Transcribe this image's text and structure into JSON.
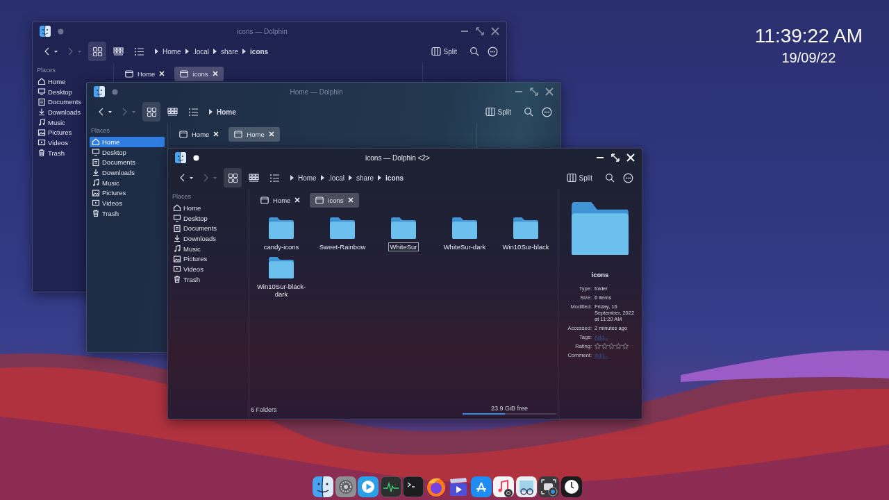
{
  "clock": {
    "time": "11:39:22 AM",
    "date": "19/09/22"
  },
  "windows": [
    {
      "title": "icons — Dolphin",
      "active": false,
      "back_disabled": false,
      "forward_disabled": true,
      "view_modes": [
        {
          "kind": "icons",
          "selected": true
        },
        {
          "kind": "compact",
          "selected": false
        },
        {
          "kind": "details",
          "selected": false
        }
      ],
      "breadcrumb": [
        "Home",
        ".local",
        "share",
        "icons"
      ],
      "split_label": "Split",
      "tabs": [
        {
          "label": "Home",
          "selected": false
        },
        {
          "label": "icons",
          "selected": true
        }
      ],
      "places_title": "Places",
      "places": [
        {
          "label": "Home",
          "kind": "home",
          "selected": false
        },
        {
          "label": "Desktop",
          "kind": "desktop",
          "selected": false
        },
        {
          "label": "Documents",
          "kind": "documents",
          "selected": false
        },
        {
          "label": "Downloads",
          "kind": "downloads",
          "selected": false
        },
        {
          "label": "Music",
          "kind": "music",
          "selected": false
        },
        {
          "label": "Pictures",
          "kind": "pictures",
          "selected": false
        },
        {
          "label": "Videos",
          "kind": "videos",
          "selected": false
        },
        {
          "label": "Trash",
          "kind": "trash",
          "selected": false
        }
      ]
    },
    {
      "title": "Home — Dolphin",
      "active": false,
      "back_disabled": false,
      "forward_disabled": true,
      "view_modes": [
        {
          "kind": "icons",
          "selected": true
        },
        {
          "kind": "compact",
          "selected": false
        },
        {
          "kind": "details",
          "selected": false
        }
      ],
      "breadcrumb": [
        "Home"
      ],
      "split_label": "Split",
      "tabs": [
        {
          "label": "Home",
          "selected": false
        },
        {
          "label": "Home",
          "selected": true
        }
      ],
      "places_title": "Places",
      "places": [
        {
          "label": "Home",
          "kind": "home",
          "selected": true
        },
        {
          "label": "Desktop",
          "kind": "desktop",
          "selected": false
        },
        {
          "label": "Documents",
          "kind": "documents",
          "selected": false
        },
        {
          "label": "Downloads",
          "kind": "downloads",
          "selected": false
        },
        {
          "label": "Music",
          "kind": "music",
          "selected": false
        },
        {
          "label": "Pictures",
          "kind": "pictures",
          "selected": false
        },
        {
          "label": "Videos",
          "kind": "videos",
          "selected": false
        },
        {
          "label": "Trash",
          "kind": "trash",
          "selected": false
        }
      ]
    },
    {
      "title": "icons — Dolphin <2>",
      "active": true,
      "back_disabled": false,
      "forward_disabled": true,
      "view_modes": [
        {
          "kind": "icons",
          "selected": true
        },
        {
          "kind": "compact",
          "selected": false
        },
        {
          "kind": "details",
          "selected": false
        }
      ],
      "breadcrumb": [
        "Home",
        ".local",
        "share",
        "icons"
      ],
      "split_label": "Split",
      "tabs": [
        {
          "label": "Home",
          "selected": false
        },
        {
          "label": "icons",
          "selected": true
        }
      ],
      "places_title": "Places",
      "places": [
        {
          "label": "Home",
          "kind": "home",
          "selected": false
        },
        {
          "label": "Desktop",
          "kind": "desktop",
          "selected": false
        },
        {
          "label": "Documents",
          "kind": "documents",
          "selected": false
        },
        {
          "label": "Downloads",
          "kind": "downloads",
          "selected": false
        },
        {
          "label": "Music",
          "kind": "music",
          "selected": false
        },
        {
          "label": "Pictures",
          "kind": "pictures",
          "selected": false
        },
        {
          "label": "Videos",
          "kind": "videos",
          "selected": false
        },
        {
          "label": "Trash",
          "kind": "trash",
          "selected": false
        }
      ],
      "files": [
        {
          "name": "candy-icons",
          "focused": false
        },
        {
          "name": "Sweet-Rainbow",
          "focused": false
        },
        {
          "name": "WhiteSur",
          "focused": true
        },
        {
          "name": "WhiteSur-dark",
          "focused": false
        },
        {
          "name": "Win10Sur-black",
          "focused": false
        },
        {
          "name": "Win10Sur-black-dark",
          "focused": false
        }
      ],
      "status": {
        "count": "6 Folders",
        "free": "23.9 GiB free",
        "level": 0.45
      },
      "info_panel": {
        "name": "icons",
        "rows": [
          {
            "kind": "text",
            "label": "Type:",
            "value": "folder"
          },
          {
            "kind": "text",
            "label": "Size:",
            "value": "6 items"
          },
          {
            "kind": "text",
            "label": "Modified:",
            "value": "Friday, 16 September, 2022 at 11:20 AM"
          },
          {
            "kind": "text",
            "label": "Accessed:",
            "value": "2 minutes ago"
          },
          {
            "kind": "link",
            "label": "Tags:",
            "value": "Add..."
          },
          {
            "kind": "stars",
            "label": "Rating:",
            "stars": 0
          },
          {
            "kind": "link",
            "label": "Comment:",
            "value": "Add..."
          }
        ]
      }
    }
  ],
  "dock": [
    {
      "kind": "finder"
    },
    {
      "kind": "settings"
    },
    {
      "kind": "player"
    },
    {
      "kind": "monitor"
    },
    {
      "kind": "terminal"
    },
    {
      "kind": "browser"
    },
    {
      "kind": "video-editor"
    },
    {
      "kind": "store"
    },
    {
      "kind": "music"
    },
    {
      "kind": "preview"
    },
    {
      "kind": "screenshot"
    },
    {
      "kind": "clock"
    }
  ]
}
